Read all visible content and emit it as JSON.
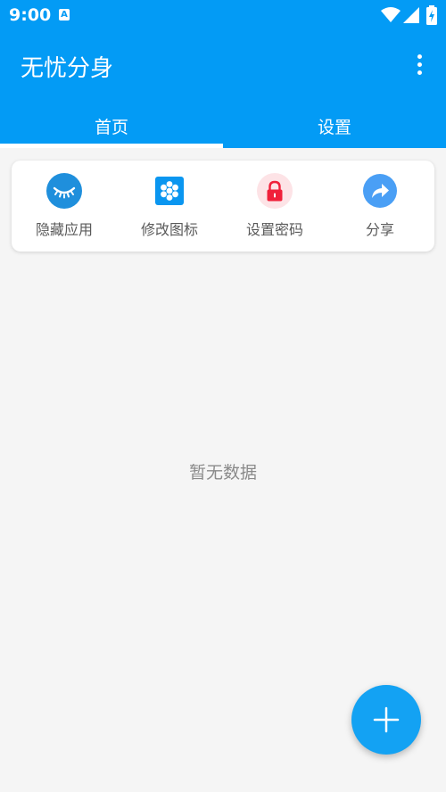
{
  "status_bar": {
    "time": "9:00",
    "notification_icon": "a-icon",
    "status_icons": [
      "wifi-icon",
      "signal-icon",
      "battery-icon"
    ]
  },
  "app_bar": {
    "title": "无忧分身",
    "menu_icon": "more-vert-icon",
    "background_color": "#039bf5"
  },
  "tabs": [
    {
      "label": "首页",
      "selected": true
    },
    {
      "label": "设置",
      "selected": false
    }
  ],
  "quick_actions": [
    {
      "label": "隐藏应用",
      "icon": "closed-eye-icon",
      "color": "#1f8fdc"
    },
    {
      "label": "修改图标",
      "icon": "hexagon-grid-icon",
      "color": "#0a96f0"
    },
    {
      "label": "设置密码",
      "icon": "lock-icon",
      "color": "#f0203a"
    },
    {
      "label": "分享",
      "icon": "share-icon",
      "color": "#4a9ff5"
    }
  ],
  "empty_state": {
    "text": "暂无数据"
  },
  "fab": {
    "icon": "plus-icon",
    "color": "#13a2f3"
  }
}
